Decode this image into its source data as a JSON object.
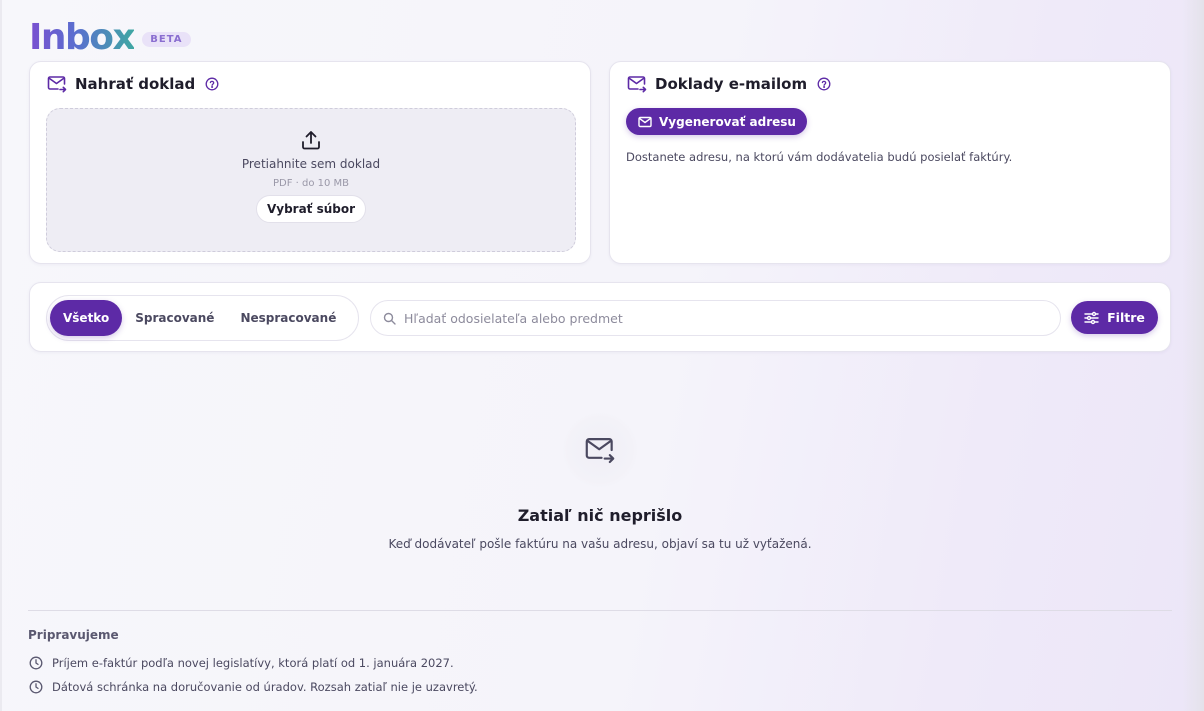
{
  "header": {
    "title": "Inbox",
    "badge": "BETA"
  },
  "upload_card": {
    "title": "Nahrať doklad",
    "drop_text": "Pretiahnite sem doklad",
    "drop_hint": "PDF · do 10 MB",
    "choose_button": "Vybrať súbor"
  },
  "email_card": {
    "title": "Doklady e-mailom",
    "generate_button": "Vygenerovať adresu",
    "description": "Dostanete adresu, na ktorú vám dodávatelia budú posielať faktúry."
  },
  "filters": {
    "tabs": [
      {
        "label": "Všetko",
        "active": true
      },
      {
        "label": "Spracované",
        "active": false
      },
      {
        "label": "Nespracované",
        "active": false
      }
    ],
    "search_placeholder": "Hľadať odosielateľa alebo predmet",
    "filter_button": "Filtre"
  },
  "empty_state": {
    "title": "Zatiaľ nič neprišlo",
    "subtitle": "Keď dodávateľ pošle faktúru na vašu adresu, objaví sa tu už vyťažená."
  },
  "upcoming": {
    "title": "Pripravujeme",
    "items": [
      "Príjem e-faktúr podľa novej legislatívy, ktorá platí od 1. januára 2027.",
      "Dátová schránka na doručovanie od úradov. Rozsah zatiaľ nie je uzavretý."
    ]
  },
  "colors": {
    "accent": "#5d2aa6",
    "accent_light": "#e9e2f8"
  }
}
